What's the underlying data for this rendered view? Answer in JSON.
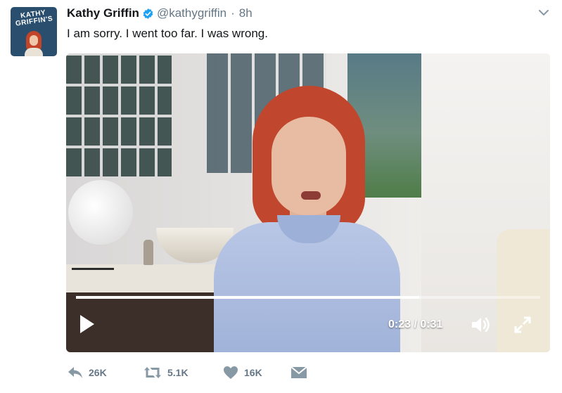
{
  "tweet": {
    "avatar": {
      "alt_text": "KATHY GRIFFIN'S"
    },
    "author_name": "Kathy Griffin",
    "verified": true,
    "handle": "@kathygriffin",
    "separator": "·",
    "time_ago": "8h",
    "text": "I am sorry.  I went too far.  I was wrong."
  },
  "video": {
    "time_display": "0:23 / 0:31",
    "progress_fraction": 0.74
  },
  "actions": {
    "reply_count": "26K",
    "retweet_count": "5.1K",
    "like_count": "16K"
  },
  "icons": {
    "verified": "verified-badge-icon",
    "chevron": "chevron-down-icon",
    "play": "play-icon",
    "volume": "volume-icon",
    "fullscreen": "fullscreen-icon",
    "reply": "reply-icon",
    "retweet": "retweet-icon",
    "like": "heart-icon",
    "dm": "envelope-icon"
  },
  "colors": {
    "verified_blue": "#1da1f2",
    "meta_gray": "#657786",
    "text": "#14171a"
  }
}
